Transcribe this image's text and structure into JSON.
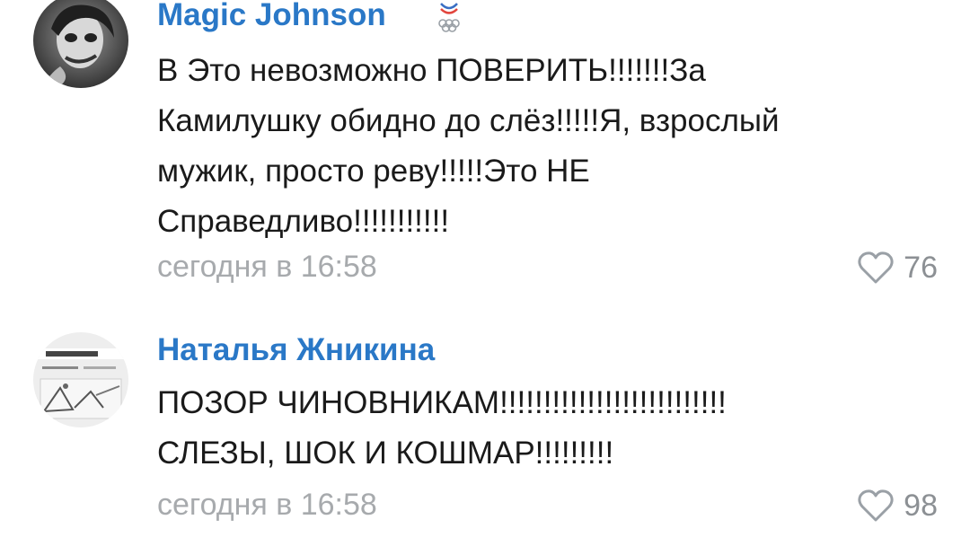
{
  "comments": [
    {
      "author": "Magic Johnson",
      "badge_icon": "olympic-rings-badge-icon",
      "avatar_icon": "joker-avatar-icon",
      "text": "В Это невозможно ПОВЕРИТЬ!!!!!!!За\nКамилушку обидно до слёз!!!!!Я, взрослый\nмужик, просто реву!!!!!Это НЕ\nСправедливо!!!!!!!!!!!",
      "time": "сегодня в 16:58",
      "likes": "76",
      "like_icon": "heart-icon"
    },
    {
      "author": "Наталья Жникина",
      "avatar_icon": "document-avatar-icon",
      "text": "ПОЗОР ЧИНОВНИКАМ!!!!!!!!!!!!!!!!!!!!!!!!!!\nСЛЕЗЫ, ШОК И КОШМАР!!!!!!!!!",
      "time": "сегодня в 16:58",
      "likes": "98",
      "like_icon": "heart-icon"
    }
  ],
  "colors": {
    "author": "#2a78c7",
    "text": "#1a1a1a",
    "meta": "#a7aaad",
    "like": "#8c9094"
  }
}
